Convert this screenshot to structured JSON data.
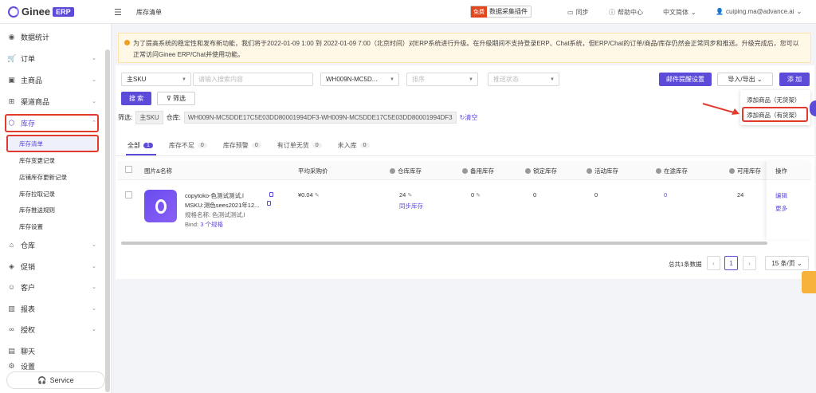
{
  "app": {
    "logo_text": "Ginee",
    "logo_badge": "ERP",
    "page_title": "库存清单"
  },
  "header": {
    "plugin_free": "免费",
    "plugin_label": "数据采集插件",
    "sync": "同步",
    "help": "帮助中心",
    "language": "中文简体",
    "user": "cuiping.ma@advance.ai"
  },
  "sidebar": {
    "items": [
      {
        "label": "数据统计",
        "icon": "dashboard-icon"
      },
      {
        "label": "订单",
        "icon": "cart-icon"
      },
      {
        "label": "主商品",
        "icon": "product-icon"
      },
      {
        "label": "渠道商品",
        "icon": "channel-icon"
      },
      {
        "label": "库存",
        "icon": "inventory-icon"
      },
      {
        "label": "仓库",
        "icon": "warehouse-icon"
      },
      {
        "label": "促销",
        "icon": "tag-icon"
      },
      {
        "label": "客户",
        "icon": "users-icon"
      },
      {
        "label": "报表",
        "icon": "chart-icon"
      },
      {
        "label": "授权",
        "icon": "link-icon"
      },
      {
        "label": "聊天",
        "icon": "chat-icon"
      },
      {
        "label": "设置",
        "icon": "settings-icon"
      }
    ],
    "sub_items": [
      "库存清单",
      "库存变更记录",
      "店铺库存更新记录",
      "库存拉取记录",
      "库存推送规则",
      "库存设置"
    ],
    "service": "Service"
  },
  "notice": "为了提高系统的稳定性和发布新功能，我们将于2022-01-09 1:00 到 2022-01-09 7:00（北京时间）对ERP系统进行升级。在升级期间不支持登录ERP、Chat系统，但ERP/Chat的订单/商品/库存仍然会正常同步和推送。升级完成后，您可以正常访问Ginee ERP/Chat并使用功能。",
  "filters": {
    "sku_type": "主SKU",
    "search_placeholder": "请输入搜索内容",
    "warehouse": "WH009N-MC5D...",
    "sort_placeholder": "排序",
    "push_status_placeholder": "推送状态",
    "search_button": "搜 索",
    "filter_button": "筛选"
  },
  "actions": {
    "email_alert": "邮件提醒设置",
    "import_export": "导入/导出",
    "add": "添 加"
  },
  "dropdown": {
    "no_stock": "添加商品（无货架）",
    "with_stock": "添加商品（有货架）"
  },
  "active_filter": {
    "label": "筛选:",
    "tag": "主SKU",
    "warehouse_label": "仓库:",
    "warehouse_value": "WH009N-MC5DDE17C5E03DD80001994DF3-WH009N-MC5DDE17C5E03DD80001994DF3",
    "clear": "清空"
  },
  "tabs": [
    {
      "label": "全部",
      "count": "1"
    },
    {
      "label": "库存不足",
      "count": "0"
    },
    {
      "label": "库存预警",
      "count": "0"
    },
    {
      "label": "有订单无货",
      "count": "0"
    },
    {
      "label": "未入库",
      "count": "0"
    }
  ],
  "table": {
    "headers": {
      "name": "图片&名称",
      "avg_price": "平均采购价",
      "warehouse_stock": "仓库库存",
      "spare_stock": "备用库存",
      "locked_stock": "锁定库存",
      "promo_stock": "活动库存",
      "transit_stock": "在途库存",
      "available_stock": "可用库存",
      "ops": "操作"
    },
    "rows": [
      {
        "name": "copytoko-色测试测试,l",
        "msku": "MSKU:测色sees2021年12...",
        "spec": "规格名称: 色测试测试,l",
        "bind_label": "Bind:",
        "bind_link": "3 个规格",
        "avg_price": "¥0.04",
        "warehouse_stock": "24",
        "sync_link": "同步库存",
        "spare_stock": "0",
        "locked_stock": "0",
        "promo_stock": "0",
        "transit_stock": "0",
        "available_stock": "24",
        "edit": "编辑",
        "more": "更多"
      }
    ]
  },
  "pagination": {
    "total": "总共1条数据",
    "page": "1",
    "per_page": "15 条/页"
  },
  "colors": {
    "brand": "#5c4bd8",
    "highlight": "#e13b2d",
    "notice_bg": "#fff8e6"
  }
}
